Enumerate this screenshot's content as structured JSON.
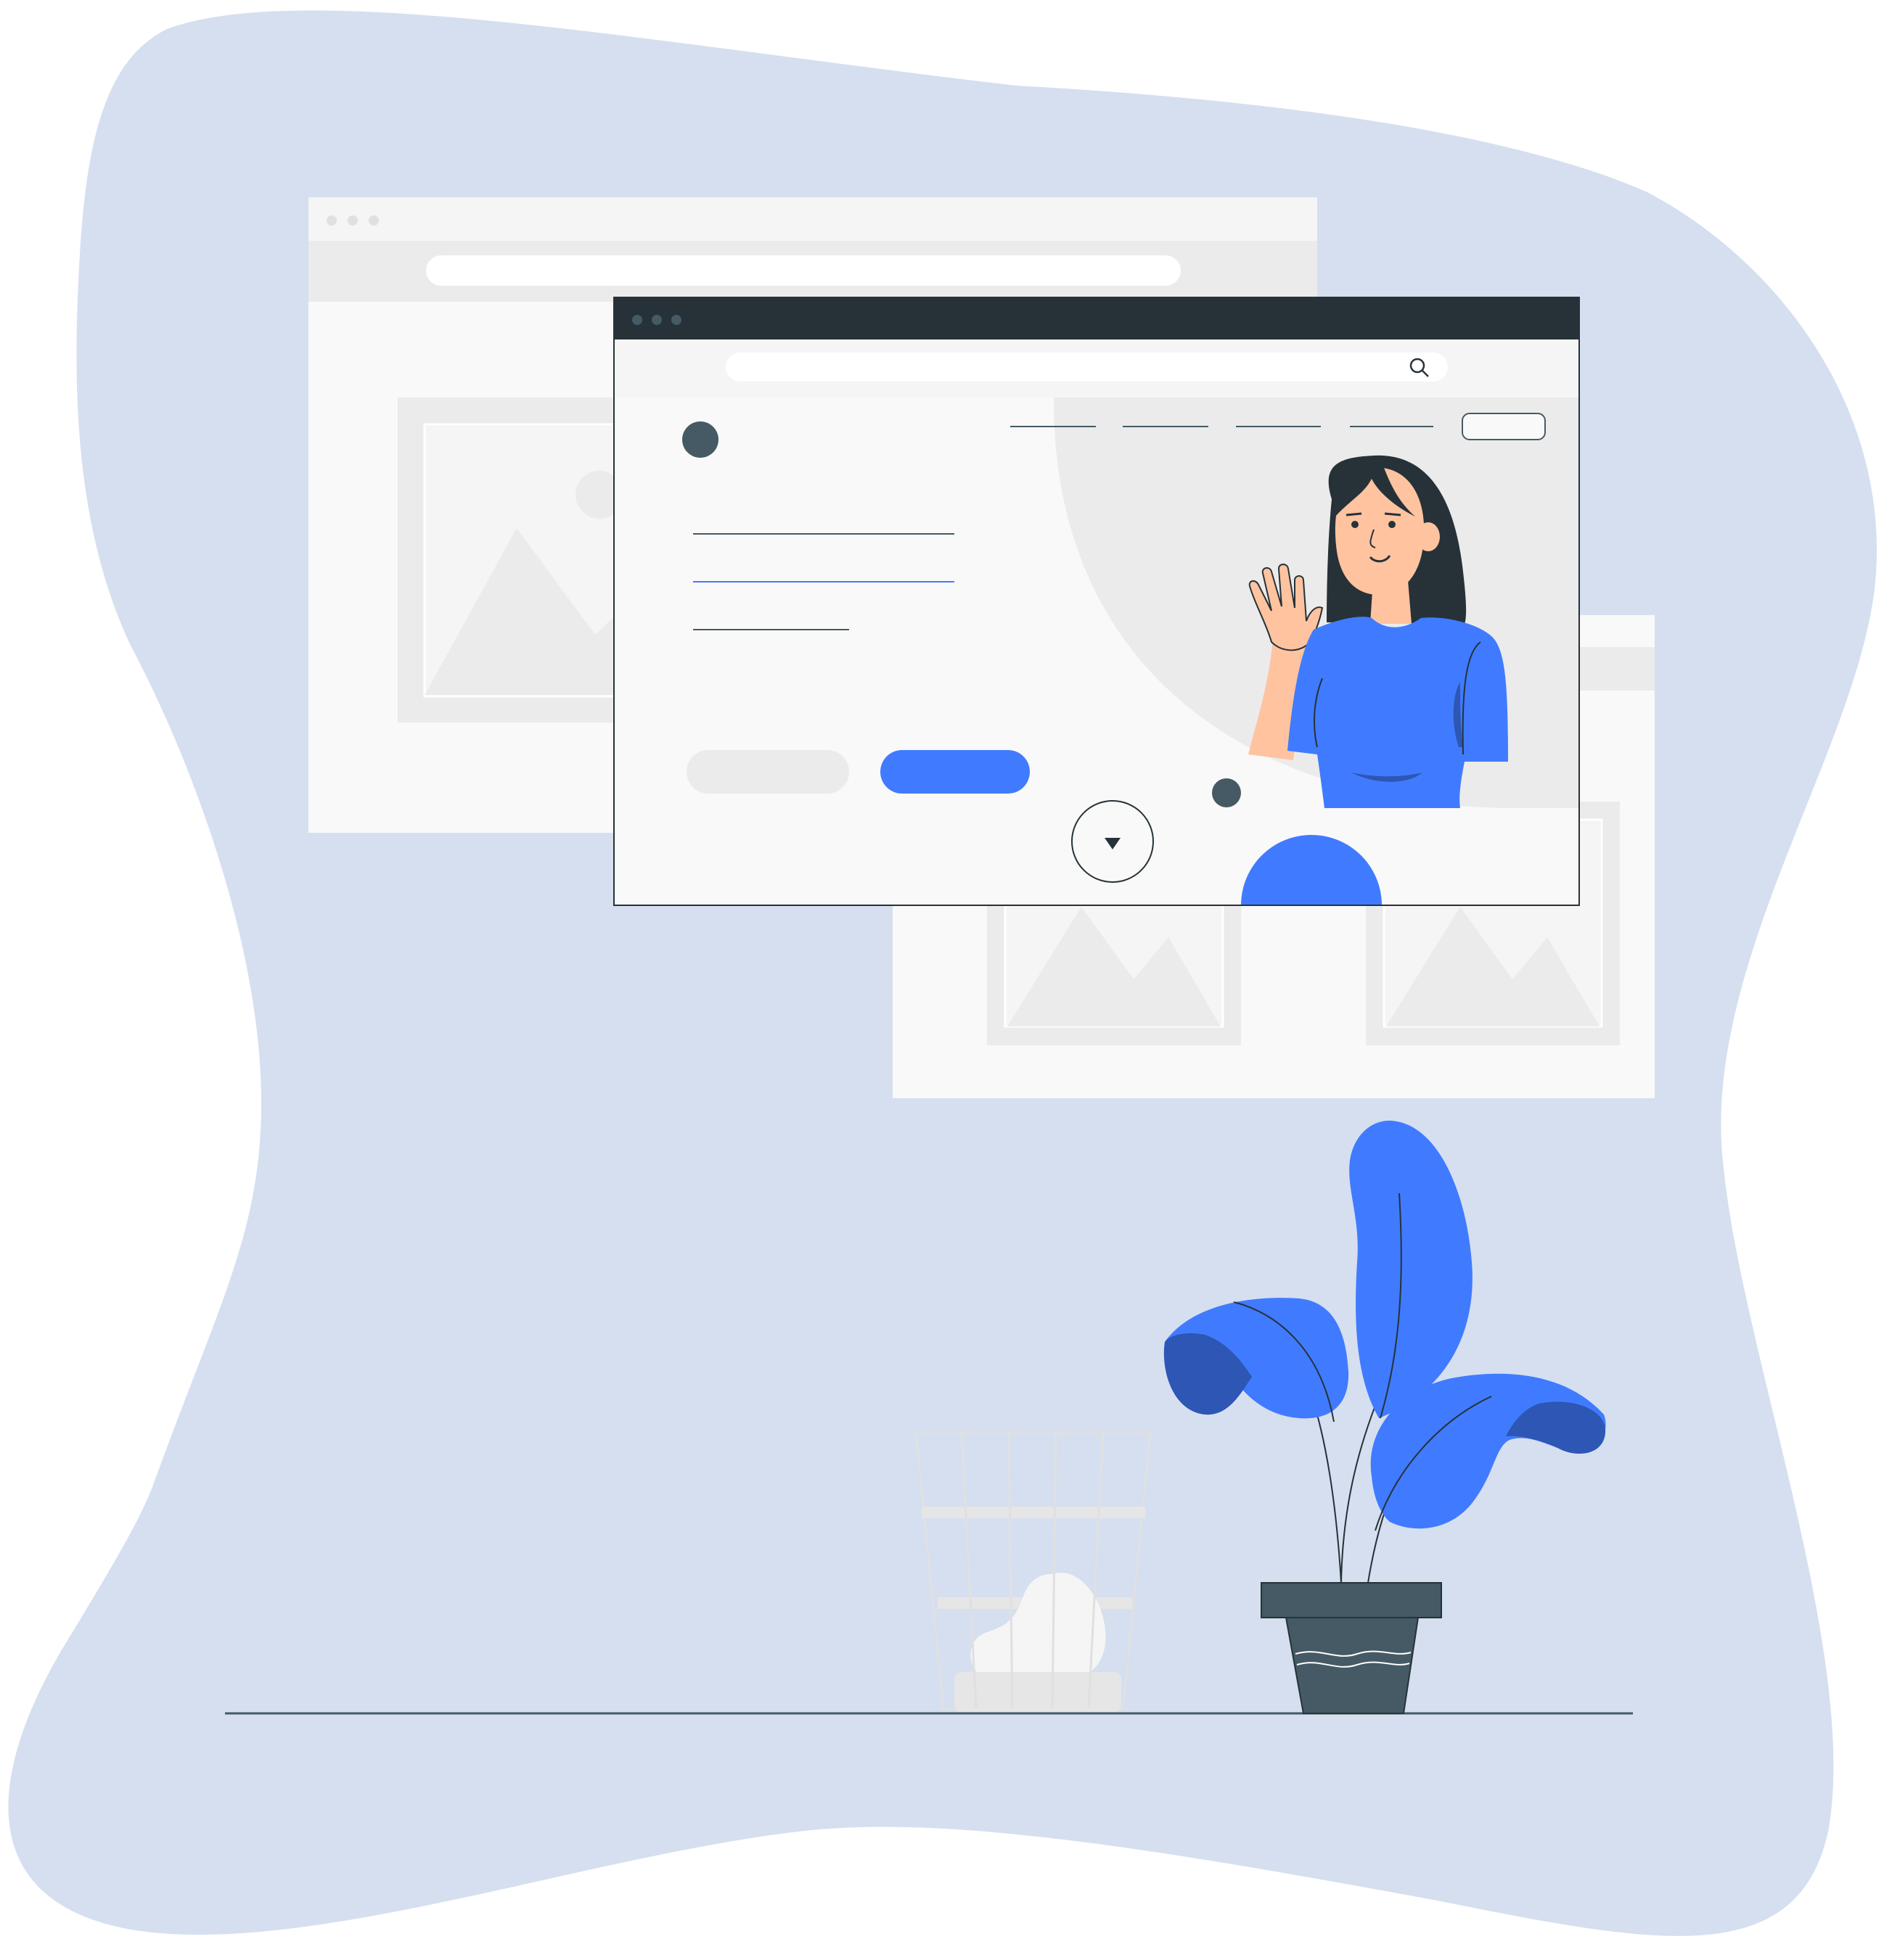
{
  "scene": {
    "type": "illustration",
    "subject": "website-landing-page-mockup",
    "windows": [
      {
        "role": "background-window-left",
        "content": [
          "address-bar",
          "image-placeholder"
        ]
      },
      {
        "role": "background-window-right",
        "content": [
          "image-placeholder",
          "image-placeholder"
        ]
      },
      {
        "role": "main-browser-window",
        "content": [
          "address-bar",
          "search-icon",
          "logo-dot",
          "nav-links",
          "nav-button",
          "text-lines",
          "secondary-button",
          "primary-button",
          "scroll-down-button",
          "person-waving"
        ]
      }
    ],
    "props": [
      "potted-plant",
      "wire-wastebasket",
      "floor-line"
    ]
  },
  "colors": {
    "blob": "#d5dff0",
    "accent_blue": "#407bff",
    "dark_blue": "#2d56b5",
    "dark_slate": "#455a64",
    "titlebar": "#263238",
    "window_bg": "#f9f9f9",
    "bar_bg": "#f5f5f5",
    "placeholder": "#ebebeb",
    "skin": "#ffc3a0",
    "hair": "#263238"
  }
}
